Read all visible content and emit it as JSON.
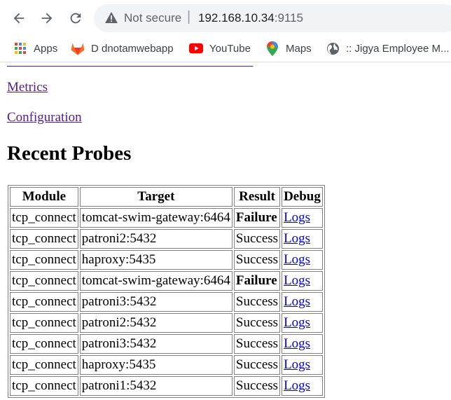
{
  "browser": {
    "not_secure": "Not secure",
    "url_host": "192.168.10.34",
    "url_port": ":9115",
    "bookmarks": [
      {
        "label": "Apps",
        "icon": "apps-grid-icon"
      },
      {
        "label": "D dnotamwebapp",
        "icon": "gitlab-icon"
      },
      {
        "label": "YouTube",
        "icon": "youtube-icon"
      },
      {
        "label": "Maps",
        "icon": "maps-pin-icon"
      },
      {
        "label": ":: Jigya Employee M...",
        "icon": "globe-icon"
      }
    ]
  },
  "page": {
    "links": {
      "metrics": "Metrics",
      "configuration": "Configuration"
    },
    "heading": "Recent Probes",
    "table": {
      "headers": [
        "Module",
        "Target",
        "Result",
        "Debug"
      ],
      "rows": [
        {
          "module": "tcp_connect",
          "target": "tomcat-swim-gateway:6464",
          "result": "Failure",
          "debug": "Logs"
        },
        {
          "module": "tcp_connect",
          "target": "patroni2:5432",
          "result": "Success",
          "debug": "Logs"
        },
        {
          "module": "tcp_connect",
          "target": "haproxy:5435",
          "result": "Success",
          "debug": "Logs"
        },
        {
          "module": "tcp_connect",
          "target": "tomcat-swim-gateway:6464",
          "result": "Failure",
          "debug": "Logs"
        },
        {
          "module": "tcp_connect",
          "target": "patroni3:5432",
          "result": "Success",
          "debug": "Logs"
        },
        {
          "module": "tcp_connect",
          "target": "patroni2:5432",
          "result": "Success",
          "debug": "Logs"
        },
        {
          "module": "tcp_connect",
          "target": "patroni3:5432",
          "result": "Success",
          "debug": "Logs"
        },
        {
          "module": "tcp_connect",
          "target": "haproxy:5435",
          "result": "Success",
          "debug": "Logs"
        },
        {
          "module": "tcp_connect",
          "target": "patroni1:5432",
          "result": "Success",
          "debug": "Logs"
        }
      ]
    }
  }
}
